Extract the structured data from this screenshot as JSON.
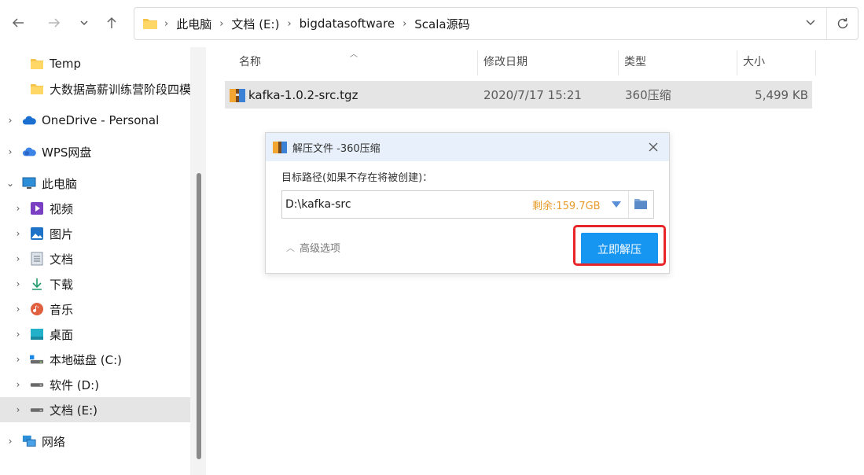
{
  "nav": {
    "back_icon": "back-arrow-icon",
    "forward_icon": "forward-arrow-icon",
    "recent_icon": "chevron-down-icon",
    "up_icon": "up-arrow-icon"
  },
  "address": {
    "crumbs": [
      "此电脑",
      "文档 (E:)",
      "bigdatasoftware",
      "Scala源码"
    ],
    "separator": "›"
  },
  "sidebar": {
    "items": [
      {
        "label": "Temp",
        "icon": "folder-icon"
      },
      {
        "label": "大数据高薪训练营阶段四模",
        "icon": "folder-icon"
      },
      {
        "label": "OneDrive - Personal",
        "icon": "cloud-icon"
      },
      {
        "label": "WPS网盘",
        "icon": "wps-cloud-icon"
      },
      {
        "label": "此电脑",
        "icon": "computer-icon"
      },
      {
        "label": "视频",
        "icon": "video-icon"
      },
      {
        "label": "图片",
        "icon": "picture-icon"
      },
      {
        "label": "文档",
        "icon": "document-icon"
      },
      {
        "label": "下载",
        "icon": "download-icon"
      },
      {
        "label": "音乐",
        "icon": "music-icon"
      },
      {
        "label": "桌面",
        "icon": "desktop-icon"
      },
      {
        "label": "本地磁盘 (C:)",
        "icon": "drive-icon"
      },
      {
        "label": "软件 (D:)",
        "icon": "drive-icon"
      },
      {
        "label": "文档 (E:)",
        "icon": "drive-icon"
      },
      {
        "label": "网络",
        "icon": "network-icon"
      }
    ]
  },
  "filelist": {
    "columns": {
      "name": "名称",
      "modified": "修改日期",
      "type": "类型",
      "size": "大小"
    },
    "rows": [
      {
        "name": "kafka-1.0.2-src.tgz",
        "modified": "2020/7/17 15:21",
        "type": "360压缩",
        "size": "5,499 KB"
      }
    ]
  },
  "dialog": {
    "title": "解压文件 -360压缩",
    "target_label": "目标路径(如果不存在将被创建)：",
    "path_value": "D:\\kafka-src",
    "free_space": "剩余:159.7GB",
    "advanced_label": "高级选项",
    "extract_button": "立即解压"
  },
  "colors": {
    "accent_button": "#1696f0",
    "free_space_text": "#e89b2a",
    "highlight_border": "#e8262a",
    "selection": "#e5e5e5"
  }
}
